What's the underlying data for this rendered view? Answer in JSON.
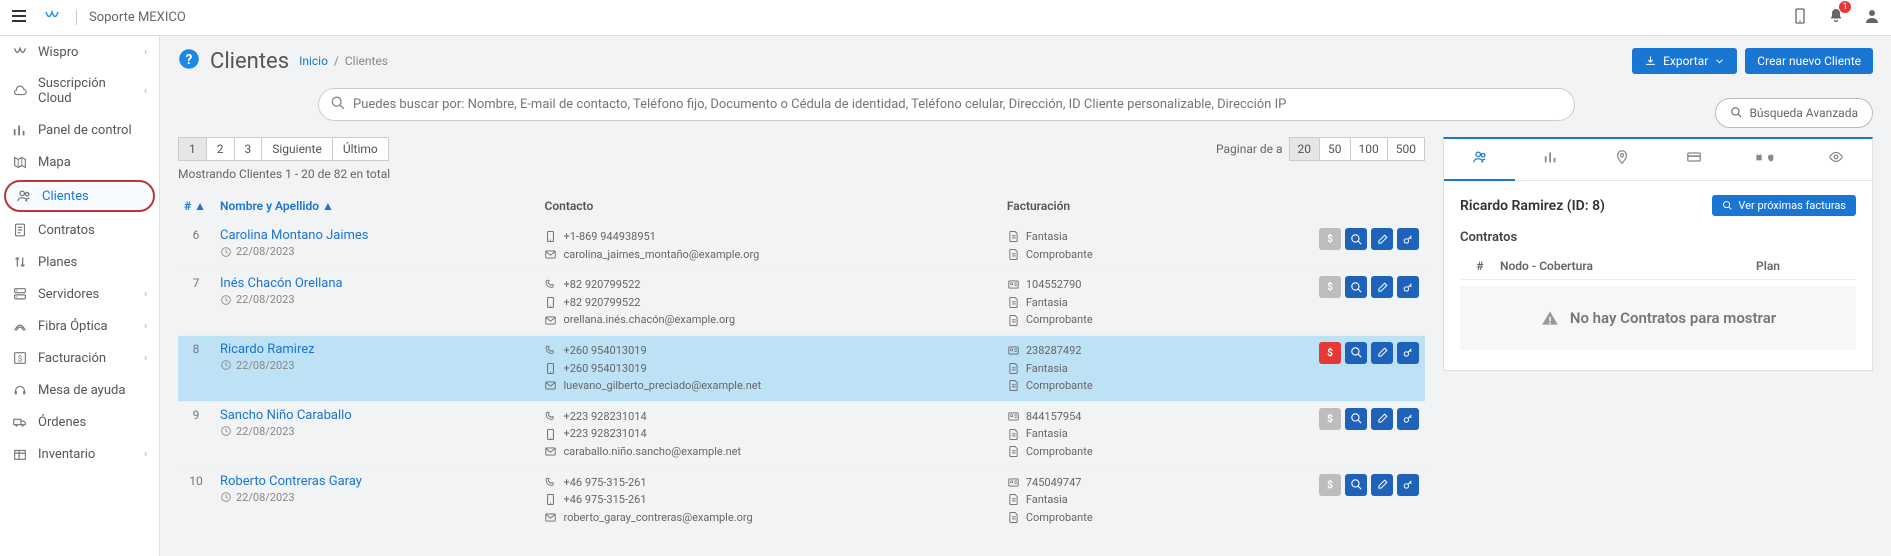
{
  "topbar": {
    "brand_text": "Soporte MEXICO",
    "notif_count": "1"
  },
  "sidebar": {
    "items": [
      {
        "label": "Wispro",
        "icon": "logo",
        "chev": true
      },
      {
        "label": "Suscripción Cloud",
        "icon": "cloud",
        "chev": true
      },
      {
        "label": "Panel de control",
        "icon": "chart"
      },
      {
        "label": "Mapa",
        "icon": "map"
      },
      {
        "label": "Clientes",
        "icon": "users",
        "active": true
      },
      {
        "label": "Contratos",
        "icon": "doc"
      },
      {
        "label": "Planes",
        "icon": "updown"
      },
      {
        "label": "Servidores",
        "icon": "server",
        "chev": true
      },
      {
        "label": "Fibra Óptica",
        "icon": "fiber",
        "chev": true
      },
      {
        "label": "Facturación",
        "icon": "billing",
        "chev": true
      },
      {
        "label": "Mesa de ayuda",
        "icon": "headset"
      },
      {
        "label": "Órdenes",
        "icon": "truck"
      },
      {
        "label": "Inventario",
        "icon": "inventory",
        "chev": true
      }
    ]
  },
  "header": {
    "title": "Clientes",
    "breadcrumb_home": "Inicio",
    "breadcrumb_current": "Clientes",
    "export_label": "Exportar",
    "create_label": "Crear nuevo Cliente"
  },
  "search": {
    "placeholder": "Puedes buscar por: Nombre, E-mail de contacto, Teléfono fijo, Documento o Cédula de identidad, Teléfono celular, Dirección, ID Cliente personalizable, Dirección IP",
    "advanced_label": "Búsqueda Avanzada"
  },
  "list": {
    "pages": [
      "1",
      "2",
      "3"
    ],
    "next_label": "Siguiente",
    "last_label": "Último",
    "perpage_label": "Paginar de a",
    "perpage_options": [
      "20",
      "50",
      "100",
      "500"
    ],
    "perpage_selected": "20",
    "showing": "Mostrando Clientes 1 - 20 de 82 en total",
    "columns": {
      "num": "#",
      "name": "Nombre y Apellido",
      "contact": "Contacto",
      "billing": "Facturación"
    },
    "rows": [
      {
        "num": "6",
        "name": "Carolina Montano Jaimes",
        "date": "22/08/2023",
        "contact": [
          {
            "icon": "mobile",
            "text": "+1-869 944938951"
          },
          {
            "icon": "mail",
            "text": "carolina_jaimes_montaño@example.org"
          }
        ],
        "billing": [
          {
            "icon": "file",
            "text": "Fantasia"
          },
          {
            "icon": "file",
            "text": "Comprobante"
          }
        ],
        "money": "gray"
      },
      {
        "num": "7",
        "name": "Inés Chacón Orellana",
        "date": "22/08/2023",
        "contact": [
          {
            "icon": "phone",
            "text": "+82 920799522"
          },
          {
            "icon": "mobile",
            "text": "+82 920799522"
          },
          {
            "icon": "mail",
            "text": "orellana.inés.chacón@example.org"
          }
        ],
        "billing": [
          {
            "icon": "id",
            "text": "104552790"
          },
          {
            "icon": "file",
            "text": "Fantasia"
          },
          {
            "icon": "file",
            "text": "Comprobante"
          }
        ],
        "money": "gray"
      },
      {
        "num": "8",
        "name": "Ricardo Ramirez",
        "date": "22/08/2023",
        "selected": true,
        "contact": [
          {
            "icon": "phone",
            "text": "+260 954013019"
          },
          {
            "icon": "mobile",
            "text": "+260 954013019"
          },
          {
            "icon": "mail",
            "text": "luevano_gilberto_preciado@example.net"
          }
        ],
        "billing": [
          {
            "icon": "id",
            "text": "238287492"
          },
          {
            "icon": "file",
            "text": "Fantasia"
          },
          {
            "icon": "file",
            "text": "Comprobante"
          }
        ],
        "money": "red"
      },
      {
        "num": "9",
        "name": "Sancho Niño Caraballo",
        "date": "22/08/2023",
        "contact": [
          {
            "icon": "phone",
            "text": "+223 928231014"
          },
          {
            "icon": "mobile",
            "text": "+223 928231014"
          },
          {
            "icon": "mail",
            "text": "caraballo.niño.sancho@example.net"
          }
        ],
        "billing": [
          {
            "icon": "id",
            "text": "844157954"
          },
          {
            "icon": "file",
            "text": "Fantasia"
          },
          {
            "icon": "file",
            "text": "Comprobante"
          }
        ],
        "money": "gray"
      },
      {
        "num": "10",
        "name": "Roberto Contreras Garay",
        "date": "22/08/2023",
        "contact": [
          {
            "icon": "phone",
            "text": "+46 975-315-261"
          },
          {
            "icon": "mobile",
            "text": "+46 975-315-261"
          },
          {
            "icon": "mail",
            "text": "roberto_garay_contreras@example.org"
          }
        ],
        "billing": [
          {
            "icon": "id",
            "text": "745049747"
          },
          {
            "icon": "file",
            "text": "Fantasia"
          },
          {
            "icon": "file",
            "text": "Comprobante"
          }
        ],
        "money": "gray"
      }
    ]
  },
  "detail": {
    "title": "Ricardo Ramirez (ID: 8)",
    "invoices_btn": "Ver próximas facturas",
    "section_contracts": "Contratos",
    "contracts_cols": {
      "num": "#",
      "node": "Nodo - Cobertura",
      "plan": "Plan"
    },
    "no_contracts": "No hay Contratos para mostrar"
  }
}
